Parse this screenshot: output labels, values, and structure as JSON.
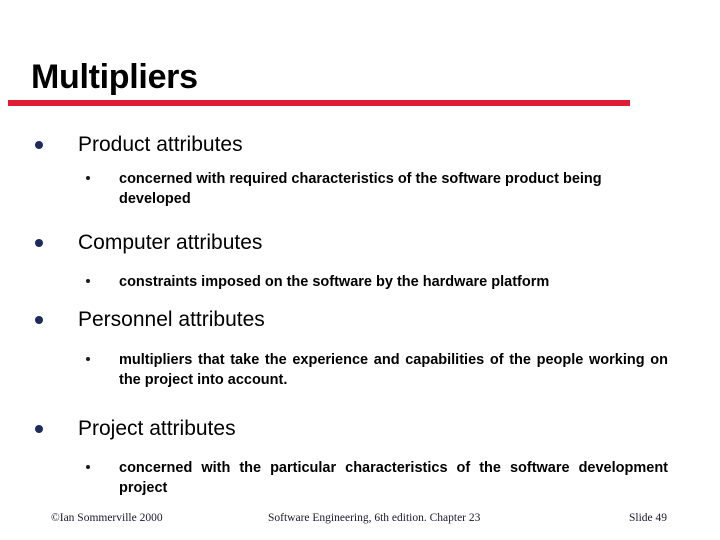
{
  "slide": {
    "title": "Multipliers",
    "accent_color": "#E01B34",
    "bullet_color": "#1F2A5C",
    "background_color": "#FFFFFF"
  },
  "sections": [
    {
      "heading": "Product attributes",
      "detail": "concerned with required characteristics of the software product being developed"
    },
    {
      "heading": "Computer attributes",
      "detail": "constraints imposed on the software by the hardware platform"
    },
    {
      "heading": "Personnel attributes",
      "detail": "multipliers that take the experience and capabilities of the people working on the project into account."
    },
    {
      "heading": "Project attributes",
      "detail": "concerned with the particular characteristics of the software development project"
    }
  ],
  "footer": {
    "left": "©Ian Sommerville 2000",
    "center": "Software Engineering, 6th edition. Chapter 23",
    "right": "Slide 49"
  }
}
